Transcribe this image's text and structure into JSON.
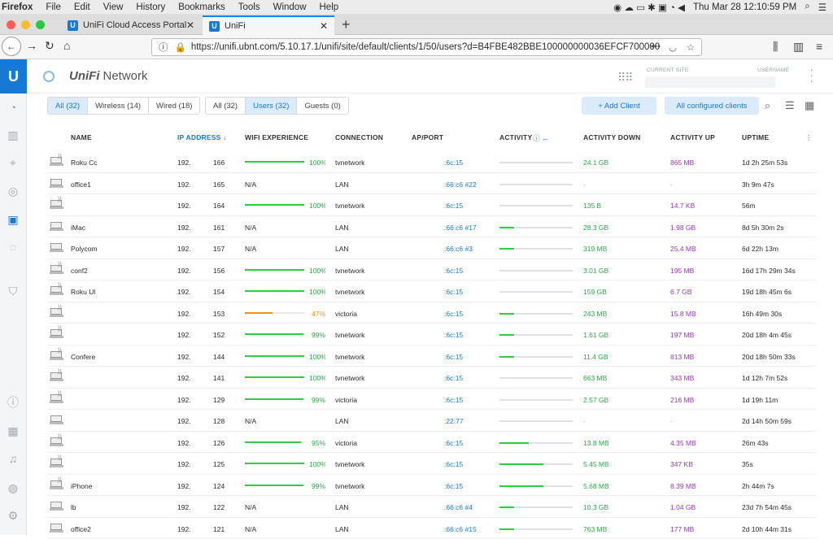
{
  "menubar": {
    "app": "Firefox",
    "items": [
      "File",
      "Edit",
      "View",
      "History",
      "Bookmarks",
      "Tools",
      "Window",
      "Help"
    ],
    "clock": "Thu Mar 28  12:10:59 PM"
  },
  "tabs": [
    {
      "label": "UniFi Cloud Access Portal",
      "icon": "U"
    },
    {
      "label": "UniFi",
      "icon": "U"
    }
  ],
  "url": "https://unifi.ubnt.com/5.10.17.1/unifi/site/default/clients/1/50/users?d=B4FBE482BBE100000000036EFCF700000",
  "app": {
    "logo": "U",
    "brand_bold": "UniFi",
    "brand_rest": "Network",
    "current_site_label": "CURRENT SITE",
    "username_label": "USERNAME"
  },
  "filters": {
    "group1": [
      "All (32)",
      "Wireless (14)",
      "Wired (18)"
    ],
    "group2": [
      "All (32)",
      "Users (32)",
      "Guests (0)"
    ],
    "add_client": "+ Add Client",
    "configured": "All configured clients"
  },
  "columns": [
    "NAME",
    "IP ADDRESS ↓",
    "WIFI EXPERIENCE",
    "CONNECTION",
    "AP/PORT",
    "ACTIVITY",
    "ACTIVITY DOWN",
    "ACTIVITY UP",
    "UPTIME"
  ],
  "accent": "#1779d6",
  "rows": [
    {
      "name": "Roku Co",
      "ip": "192.",
      "ip2": "166",
      "exp": "100%",
      "conn": "tvnetwork",
      "ap": ":6c:15",
      "act": 0,
      "down": "24.1 GB",
      "up": "865 MB",
      "uptime": "1d 2h 25m 53s",
      "wifi": true
    },
    {
      "name": "office1",
      "ip": "192.",
      "ip2": "165",
      "exp": "N/A",
      "conn": "LAN",
      "ap": ":66:c6 #22",
      "act": 0,
      "down": "-",
      "up": "-",
      "uptime": "3h 9m 47s",
      "wifi": false
    },
    {
      "name": "",
      "ip": "192.",
      "ip2": "164",
      "exp": "100%",
      "conn": "tvnetwork",
      "ap": ":6c:15",
      "act": 0,
      "down": "135 B",
      "up": "14.7 KB",
      "uptime": "56m",
      "wifi": true
    },
    {
      "name": "iMac",
      "ip": "192.",
      "ip2": "161",
      "exp": "N/A",
      "conn": "LAN",
      "ap": ":66:c6 #17",
      "act": 20,
      "down": "28.3 GB",
      "up": "1.98 GB",
      "uptime": "8d 5h 30m 2s",
      "wifi": false
    },
    {
      "name": "Polycom",
      "ip": "192.",
      "ip2": "157",
      "exp": "N/A",
      "conn": "LAN",
      "ap": ":66:c6 #3",
      "act": 20,
      "down": "319 MB",
      "up": "25.4 MB",
      "uptime": "6d 22h 13m",
      "wifi": false
    },
    {
      "name": "conf2",
      "ip": "192.",
      "ip2": "156",
      "exp": "100%",
      "conn": "tvnetwork",
      "ap": ":6c:15",
      "act": 0,
      "down": "3.01 GB",
      "up": "195 MB",
      "uptime": "16d 17h 29m 34s",
      "wifi": true
    },
    {
      "name": "Roku Ul",
      "ip": "192.",
      "ip2": "154",
      "exp": "100%",
      "conn": "tvnetwork",
      "ap": ":6c:15",
      "act": 0,
      "down": "159 GB",
      "up": "6.7 GB",
      "uptime": "19d 18h 45m 6s",
      "wifi": true
    },
    {
      "name": "",
      "ip": "192.",
      "ip2": "153",
      "exp": "47%",
      "conn": "victoria",
      "ap": ":6c:15",
      "act": 20,
      "down": "243 MB",
      "up": "15.8 MB",
      "uptime": "16h 49m 30s",
      "wifi": true
    },
    {
      "name": "",
      "ip": "192.",
      "ip2": "152",
      "exp": "99%",
      "conn": "tvnetwork",
      "ap": ":6c:15",
      "act": 20,
      "down": "1.61 GB",
      "up": "197 MB",
      "uptime": "20d 18h 4m 45s",
      "wifi": true
    },
    {
      "name": "Confere",
      "ip": "192.",
      "ip2": "144",
      "exp": "100%",
      "conn": "tvnetwork",
      "ap": ":6c:15",
      "act": 20,
      "down": "11.4 GB",
      "up": "813 MB",
      "uptime": "20d 18h 50m 33s",
      "wifi": true
    },
    {
      "name": "",
      "ip": "192.",
      "ip2": "141",
      "exp": "100%",
      "conn": "tvnetwork",
      "ap": ":6c:15",
      "act": 0,
      "down": "663 MB",
      "up": "343 MB",
      "uptime": "1d 12h 7m 52s",
      "wifi": true
    },
    {
      "name": "",
      "ip": "192.",
      "ip2": "129",
      "exp": "99%",
      "conn": "victoria",
      "ap": ":6c:15",
      "act": 0,
      "down": "2.57 GB",
      "up": "216 MB",
      "uptime": "1d 19h 11m",
      "wifi": true
    },
    {
      "name": "",
      "ip": "192.",
      "ip2": "128",
      "exp": "N/A",
      "conn": "LAN",
      "ap": ":22:77",
      "act": 0,
      "down": "-",
      "up": "-",
      "uptime": "2d 14h 50m 59s",
      "wifi": false
    },
    {
      "name": "",
      "ip": "192.",
      "ip2": "126",
      "exp": "95%",
      "conn": "victoria",
      "ap": ":6c:15",
      "act": 40,
      "down": "13.8 MB",
      "up": "4.35 MB",
      "uptime": "26m 43s",
      "wifi": true
    },
    {
      "name": "",
      "ip": "192.",
      "ip2": "125",
      "exp": "100%",
      "conn": "tvnetwork",
      "ap": ":6c:15",
      "act": 60,
      "down": "5.45 MB",
      "up": "347 KB",
      "uptime": "35s",
      "wifi": true
    },
    {
      "name": "iPhone",
      "ip": "192.",
      "ip2": "124",
      "exp": "99%",
      "conn": "tvnetwork",
      "ap": ":6c:15",
      "act": 60,
      "down": "5.68 MB",
      "up": "8.39 MB",
      "uptime": "2h 44m 7s",
      "wifi": true
    },
    {
      "name": "lb",
      "ip": "192.",
      "ip2": "122",
      "exp": "N/A",
      "conn": "LAN",
      "ap": ":66:c6 #4",
      "act": 20,
      "down": "10.3 GB",
      "up": "1.04 GB",
      "uptime": "23d 7h 54m 45s",
      "wifi": false
    },
    {
      "name": "office2",
      "ip": "192.",
      "ip2": "121",
      "exp": "N/A",
      "conn": "LAN",
      "ap": ":66:c6 #15",
      "act": 20,
      "down": "763 MB",
      "up": "177 MB",
      "uptime": "2d 10h 44m 31s",
      "wifi": false
    }
  ]
}
